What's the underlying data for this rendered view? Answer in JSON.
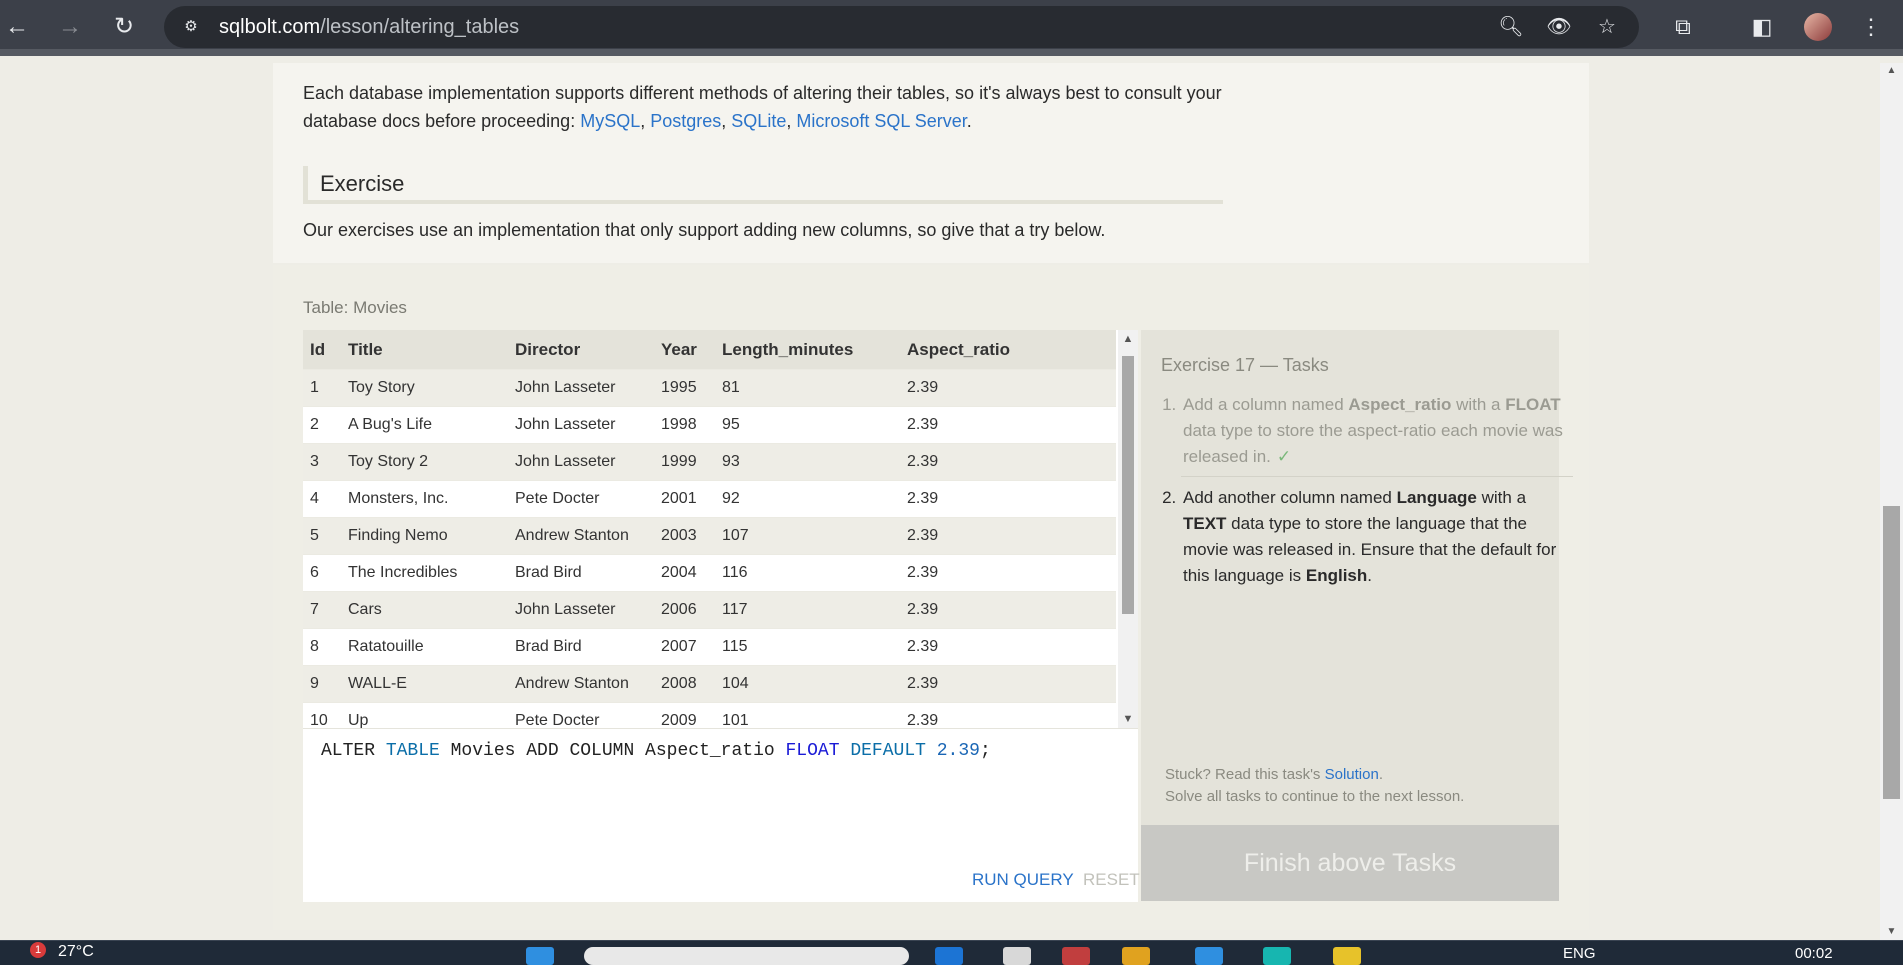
{
  "browser": {
    "url_host": "sqlbolt.com",
    "url_path": "/lesson/altering_tables"
  },
  "intro": {
    "text_before": "Each database implementation supports different methods of altering their tables, so it's always best to consult your database docs before proceeding: ",
    "links": [
      "MySQL",
      "Postgres",
      "SQLite",
      "Microsoft SQL Server"
    ],
    "text_after": "."
  },
  "exercise": {
    "heading": "Exercise",
    "description": "Our exercises use an implementation that only support adding new columns, so give that a try below."
  },
  "table": {
    "label": "Table: Movies",
    "columns": [
      "Id",
      "Title",
      "Director",
      "Year",
      "Length_minutes",
      "Aspect_ratio"
    ],
    "rows": [
      [
        "1",
        "Toy Story",
        "John Lasseter",
        "1995",
        "81",
        "2.39"
      ],
      [
        "2",
        "A Bug's Life",
        "John Lasseter",
        "1998",
        "95",
        "2.39"
      ],
      [
        "3",
        "Toy Story 2",
        "John Lasseter",
        "1999",
        "93",
        "2.39"
      ],
      [
        "4",
        "Monsters, Inc.",
        "Pete Docter",
        "2001",
        "92",
        "2.39"
      ],
      [
        "5",
        "Finding Nemo",
        "Andrew Stanton",
        "2003",
        "107",
        "2.39"
      ],
      [
        "6",
        "The Incredibles",
        "Brad Bird",
        "2004",
        "116",
        "2.39"
      ],
      [
        "7",
        "Cars",
        "John Lasseter",
        "2006",
        "117",
        "2.39"
      ],
      [
        "8",
        "Ratatouille",
        "Brad Bird",
        "2007",
        "115",
        "2.39"
      ],
      [
        "9",
        "WALL-E",
        "Andrew Stanton",
        "2008",
        "104",
        "2.39"
      ],
      [
        "10",
        "Up",
        "Pete Docter",
        "2009",
        "101",
        "2.39"
      ]
    ]
  },
  "editor": {
    "tokens": [
      {
        "t": "ALTER ",
        "c": ""
      },
      {
        "t": "TABLE",
        "c": "kw"
      },
      {
        "t": " Movies ADD COLUMN Aspect_ratio ",
        "c": ""
      },
      {
        "t": "FLOAT",
        "c": "type"
      },
      {
        "t": " ",
        "c": ""
      },
      {
        "t": "DEFAULT",
        "c": "kw"
      },
      {
        "t": " ",
        "c": ""
      },
      {
        "t": "2.39",
        "c": "num"
      },
      {
        "t": ";",
        "c": ""
      }
    ],
    "run_label": "RUN QUERY",
    "reset_label": "RESET"
  },
  "tasks": {
    "title": "Exercise 17 — Tasks",
    "task1": {
      "a": "Add a column named ",
      "b1": "Aspect_ratio",
      "c": " with a ",
      "b2": "FLOAT",
      "d": " data type to store the aspect-ratio each movie was released in.",
      "check": "✓"
    },
    "task2": {
      "a": "Add another column named ",
      "b1": "Language",
      "c": " with a ",
      "b2": "TEXT",
      "d": " data type to store the language that the movie was released in. Ensure that the default for this language is ",
      "b3": "English",
      "e": "."
    },
    "stuck_prefix": "Stuck? Read this task's ",
    "stuck_link": "Solution",
    "stuck_suffix": ".",
    "continue_text": "Solve all tasks to continue to the next lesson.",
    "finish_label": "Finish above Tasks"
  },
  "taskbar": {
    "weather": "27°C",
    "weather_badge": "1",
    "lang": "ENG",
    "time": "00:02"
  }
}
